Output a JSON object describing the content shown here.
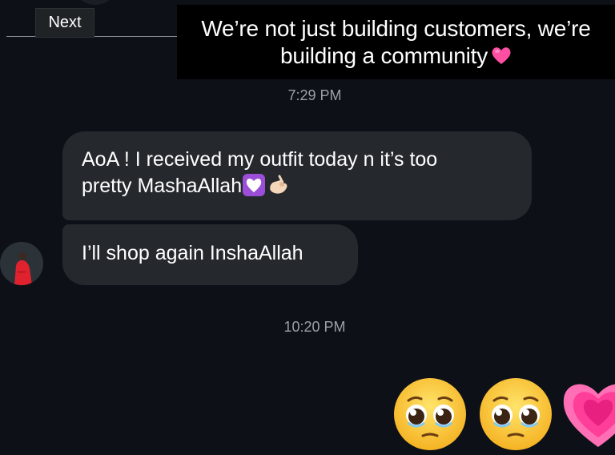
{
  "toolbar": {
    "next_label": "Next"
  },
  "caption": {
    "line1": "We’re not just building customers, we’re",
    "line2": "building a community",
    "emoji": "pink-heart"
  },
  "timestamps": {
    "first": "7:29 PM",
    "second": "10:20 PM"
  },
  "messages": [
    {
      "line1": "AoA ! I received my outfit today n it’s too",
      "line2": "pretty MashaAllah",
      "emojis": [
        "heart-with-ribbon",
        "ok-hand"
      ]
    },
    {
      "text": "I’ll shop again InshaAllah"
    }
  ],
  "reactions": [
    "pleading-face",
    "pleading-face",
    "growing-heart"
  ],
  "colors": {
    "background": "#0d1117",
    "bubble": "#25292e",
    "timestamp": "#9aa0a6",
    "caption_bg": "#000000"
  }
}
